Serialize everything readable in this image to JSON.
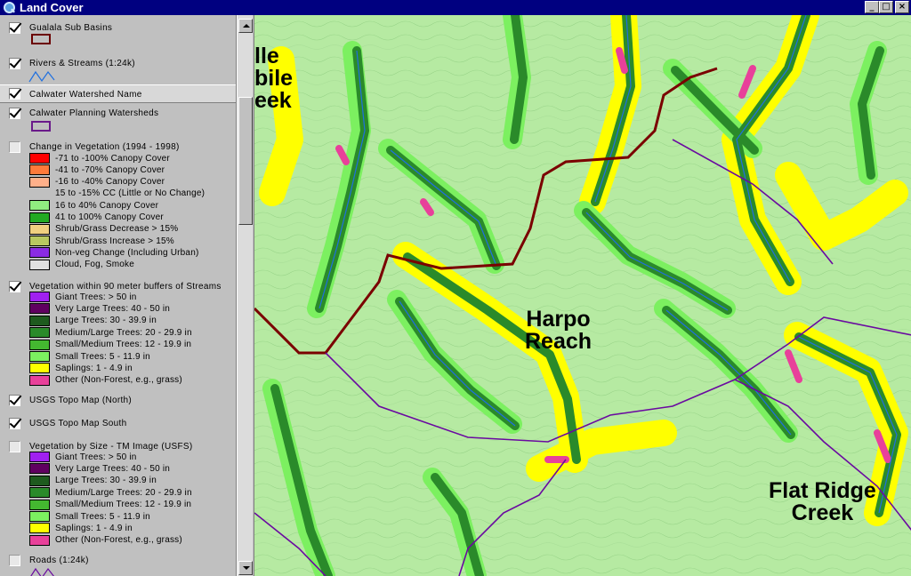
{
  "window": {
    "title": "Land Cover",
    "buttons": {
      "minimize": "_",
      "maximize": "□",
      "close": "×"
    }
  },
  "layers": [
    {
      "id": "gualala",
      "name": "Gualala Sub Basins",
      "checked": true,
      "symbol": "poly-brown"
    },
    {
      "id": "rivers",
      "name": "Rivers & Streams (1:24k)",
      "checked": true,
      "symbol": "line-blue"
    },
    {
      "id": "calwater-name",
      "name": "Calwater Watershed Name",
      "checked": true,
      "selected": true
    },
    {
      "id": "calwater-planning",
      "name": "Calwater Planning Watersheds",
      "checked": true,
      "symbol": "poly-purple"
    },
    {
      "id": "change-veg",
      "name": "Change in Vegetation (1994 - 1998)",
      "checked": false
    },
    {
      "id": "veg-buffers",
      "name": "Vegetation within 90 meter buffers of Streams",
      "checked": true
    },
    {
      "id": "topo-north",
      "name": "USGS Topo Map (North)",
      "checked": true
    },
    {
      "id": "topo-south",
      "name": "USGS Topo Map South",
      "checked": true
    },
    {
      "id": "veg-size",
      "name": "Vegetation by Size - TM Image (USFS)",
      "checked": false
    },
    {
      "id": "roads",
      "name": "Roads (1:24k)",
      "checked": false,
      "symbol": "line-purple"
    }
  ],
  "change_classes": [
    {
      "label": "-71 to -100% Canopy Cover",
      "color": "#ff0000"
    },
    {
      "label": "-41 to -70% Canopy Cover",
      "color": "#ff7a3a"
    },
    {
      "label": "-16 to -40% Canopy Cover",
      "color": "#ffb08a"
    },
    {
      "label": "15 to -15% CC (Little or No Change)",
      "color": ""
    },
    {
      "label": "16 to 40% Canopy Cover",
      "color": "#90ee80"
    },
    {
      "label": "41 to 100% Canopy Cover",
      "color": "#22aa22"
    },
    {
      "label": "Shrub/Grass Decrease > 15%",
      "color": "#f0d080"
    },
    {
      "label": "Shrub/Grass Increase > 15%",
      "color": "#b8c860"
    },
    {
      "label": "Non-veg Change (Including Urban)",
      "color": "#8a2be2"
    },
    {
      "label": "Cloud, Fog, Smoke",
      "color": "#e0e0e0"
    }
  ],
  "size_classes_buffers": [
    {
      "label": "Giant Trees: > 50 in",
      "color": "#a020f0"
    },
    {
      "label": "Very Large Trees: 40 - 50 in",
      "color": "#600060"
    },
    {
      "label": "Large Trees: 30 - 39.9 in",
      "color": "#1e5a1e"
    },
    {
      "label": "Medium/Large Trees: 20 - 29.9 in",
      "color": "#2a8a2a"
    },
    {
      "label": "Small/Medium Trees: 12 - 19.9 in",
      "color": "#44b830"
    },
    {
      "label": "Small Trees: 5 - 11.9 in",
      "color": "#7cf060"
    },
    {
      "label": "Saplings: 1 - 4.9 in",
      "color": "#ffff00"
    },
    {
      "label": "Other (Non-Forest, e.g., grass)",
      "color": "#e8409a"
    }
  ],
  "size_classes_tm": [
    {
      "label": "Giant Trees: > 50 in",
      "color": "#a020f0"
    },
    {
      "label": "Very Large Trees: 40 - 50 in",
      "color": "#600060"
    },
    {
      "label": "Large Trees: 30 - 39.9 in",
      "color": "#1e5a1e"
    },
    {
      "label": "Medium/Large Trees: 20 - 29.9 in",
      "color": "#2a8a2a"
    },
    {
      "label": "Small/Medium Trees: 12 - 19.9 in",
      "color": "#44b830"
    },
    {
      "label": "Small Trees: 5 - 11.9 in",
      "color": "#7cf060"
    },
    {
      "label": "Saplings: 1 - 4.9 in",
      "color": "#ffff00"
    },
    {
      "label": "Other (Non-Forest, e.g., grass)",
      "color": "#e8409a"
    }
  ],
  "map": {
    "labels": {
      "top_left": [
        "lle",
        "bile",
        "eek"
      ],
      "harpo": [
        "Harpo",
        "Reach"
      ],
      "flat_ridge": [
        "Flat Ridge",
        "Creek"
      ]
    },
    "colors": {
      "background": "#b6eaa2",
      "stream": "#1e6fe0",
      "watershed": "#7a0000",
      "road": "#6a0aa0"
    }
  }
}
